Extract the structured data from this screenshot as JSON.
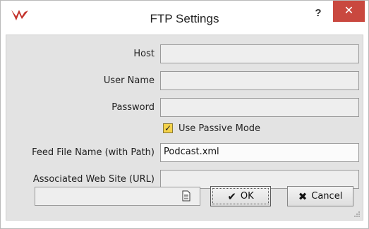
{
  "window": {
    "title": "FTP Settings",
    "help_label": "?",
    "close_label": "✕",
    "app_icon": "wavelab-logo-icon"
  },
  "form": {
    "host": {
      "label": "Host",
      "value": ""
    },
    "user_name": {
      "label": "User Name",
      "value": ""
    },
    "password": {
      "label": "Password",
      "value": ""
    },
    "passive_mode": {
      "label": "Use Passive Mode",
      "checked": true,
      "check_mark": "✓"
    },
    "feed_file": {
      "label": "Feed File Name (with Path)",
      "value": "Podcast.xml"
    },
    "web_site": {
      "label": "Associated Web Site (URL)",
      "value": ""
    }
  },
  "footer": {
    "preset_value": "",
    "preset_icon": "document-icon",
    "ok_icon": "✔",
    "ok_label": "OK",
    "cancel_icon": "✖",
    "cancel_label": "Cancel"
  }
}
